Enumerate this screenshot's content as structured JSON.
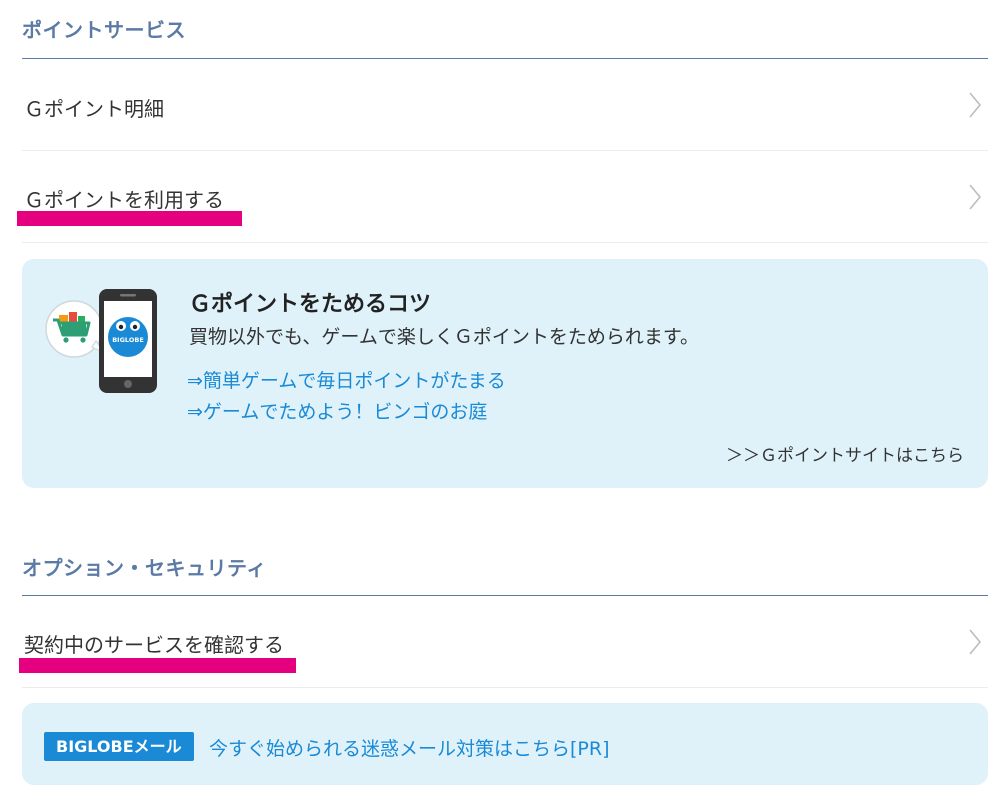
{
  "points_section": {
    "title": "ポイントサービス",
    "items": [
      {
        "label": "Ｇポイント明細"
      },
      {
        "label": "Ｇポイントを利用する"
      }
    ]
  },
  "tips": {
    "title": "Ｇポイントをためるコツ",
    "description": "買物以外でも、ゲームで楽しくＧポイントをためられます。",
    "links": [
      "⇒簡単ゲームで毎日ポイントがたまる",
      "⇒ゲームでためよう！ビンゴのお庭"
    ],
    "site_link": "＞＞Ｇポイントサイトはこちら",
    "illustration_text": "BIGLOBE"
  },
  "options_section": {
    "title": "オプション・セキュリティ",
    "items": [
      {
        "label": "契約中のサービスを確認する"
      }
    ]
  },
  "pr": {
    "badge": "BIGLOBEメール",
    "link": "今すぐ始められる迷惑メール対策はこちら[PR]"
  },
  "colors": {
    "section_title": "#5b7aa5",
    "highlight": "#e4007f",
    "box_background": "#dff2fa",
    "link": "#1a8ad6"
  },
  "icons": {
    "row_chevron": "chevron-right-icon",
    "illustration": "smartphone-shopping-cart-icon"
  }
}
